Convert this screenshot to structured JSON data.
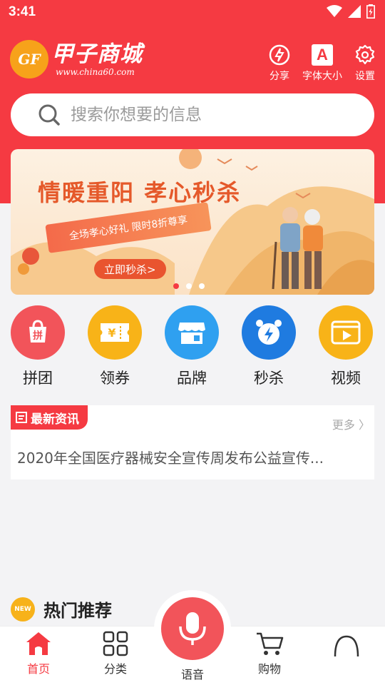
{
  "status_bar": {
    "time": "3:41"
  },
  "header": {
    "logo_badge": "GF",
    "logo_name": "甲子商城",
    "logo_url": "www.china60.com",
    "actions": [
      {
        "label": "分享",
        "icon": "share-icon"
      },
      {
        "label": "字体大小",
        "icon": "font-size-icon",
        "glyph": "A"
      },
      {
        "label": "设置",
        "icon": "gear-icon"
      }
    ]
  },
  "search": {
    "placeholder": "搜索你想要的信息"
  },
  "banner": {
    "title": "情暖重阳 孝心秒杀",
    "subtitle": "全场孝心好礼 限时8折尊享",
    "button": "立即秒杀>",
    "slide_count": 3,
    "active_slide": 1
  },
  "categories": [
    {
      "label": "拼团",
      "icon": "group-buy-icon",
      "color": "#f2545a",
      "glyph": "拼"
    },
    {
      "label": "领券",
      "icon": "coupon-icon",
      "color": "#f8b318",
      "glyph": "¥"
    },
    {
      "label": "品牌",
      "icon": "brand-store-icon",
      "color": "#2fa0f0"
    },
    {
      "label": "秒杀",
      "icon": "flash-sale-clock-icon",
      "color": "#1f7be0"
    },
    {
      "label": "视频",
      "icon": "video-icon",
      "color": "#f8b318"
    }
  ],
  "news": {
    "tag": "最新资讯",
    "more": "更多 〉",
    "headline": "2020年全国医疗器械安全宣传周发布公益宣传..."
  },
  "hot": {
    "badge": "NEW",
    "title": "热门推荐"
  },
  "tabbar": {
    "tabs": [
      {
        "label": "首页",
        "icon": "home-icon",
        "active": true
      },
      {
        "label": "分类",
        "icon": "grid-icon",
        "active": false
      },
      {
        "label": "语音",
        "icon": "microphone-icon",
        "active": false
      },
      {
        "label": "购物",
        "icon": "cart-icon",
        "active": false
      },
      {
        "label": "",
        "icon": "profile-icon",
        "active": false
      }
    ]
  },
  "colors": {
    "brand": "#f53a42",
    "accent_orange": "#f8b318"
  }
}
